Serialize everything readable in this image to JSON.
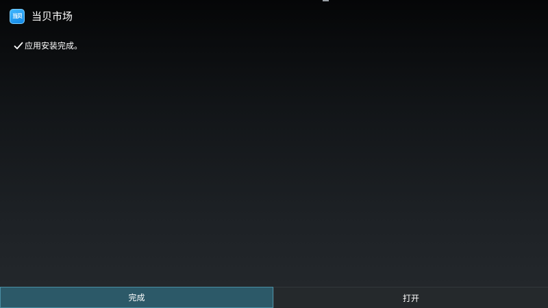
{
  "app": {
    "title": "当贝市场",
    "icon": {
      "name": "dangbei-market-app-icon",
      "label": "当贝",
      "color": "#1e9bf0"
    }
  },
  "status": {
    "icon": "check-icon",
    "message": "应用安装完成。"
  },
  "buttons": {
    "done_label": "完成",
    "open_label": "打开"
  },
  "colors": {
    "done_button_bg": "#2c5968",
    "done_button_border": "#4a8fa4",
    "open_button_bg": "#25292c",
    "text": "#ffffff"
  }
}
